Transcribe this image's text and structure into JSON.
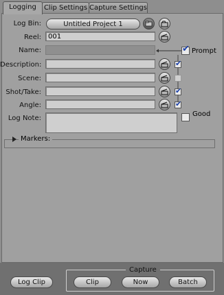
{
  "tabs": [
    {
      "label": "Logging"
    },
    {
      "label": "Clip Settings"
    },
    {
      "label": "Capture Settings"
    }
  ],
  "log_bin": {
    "label": "Log Bin:",
    "value": "Untitled Project 1"
  },
  "reel": {
    "label": "Reel:",
    "value": "001"
  },
  "name": {
    "label": "Name:",
    "value": ""
  },
  "prompt": {
    "label": "Prompt",
    "checked": true
  },
  "fields": [
    {
      "label": "Description:",
      "value": "",
      "checked": true
    },
    {
      "label": "Scene:",
      "value": "",
      "checked": false
    },
    {
      "label": "Shot/Take:",
      "value": "",
      "checked": true
    },
    {
      "label": "Angle:",
      "value": "",
      "checked": true
    }
  ],
  "log_note": {
    "label": "Log Note:",
    "value": ""
  },
  "good": {
    "label": "Good",
    "checked": false
  },
  "markers": {
    "label": "Markers:"
  },
  "bottom": {
    "log_clip_label": "Log Clip",
    "capture_title": "Capture",
    "clip_label": "Clip",
    "now_label": "Now",
    "batch_label": "Batch"
  }
}
